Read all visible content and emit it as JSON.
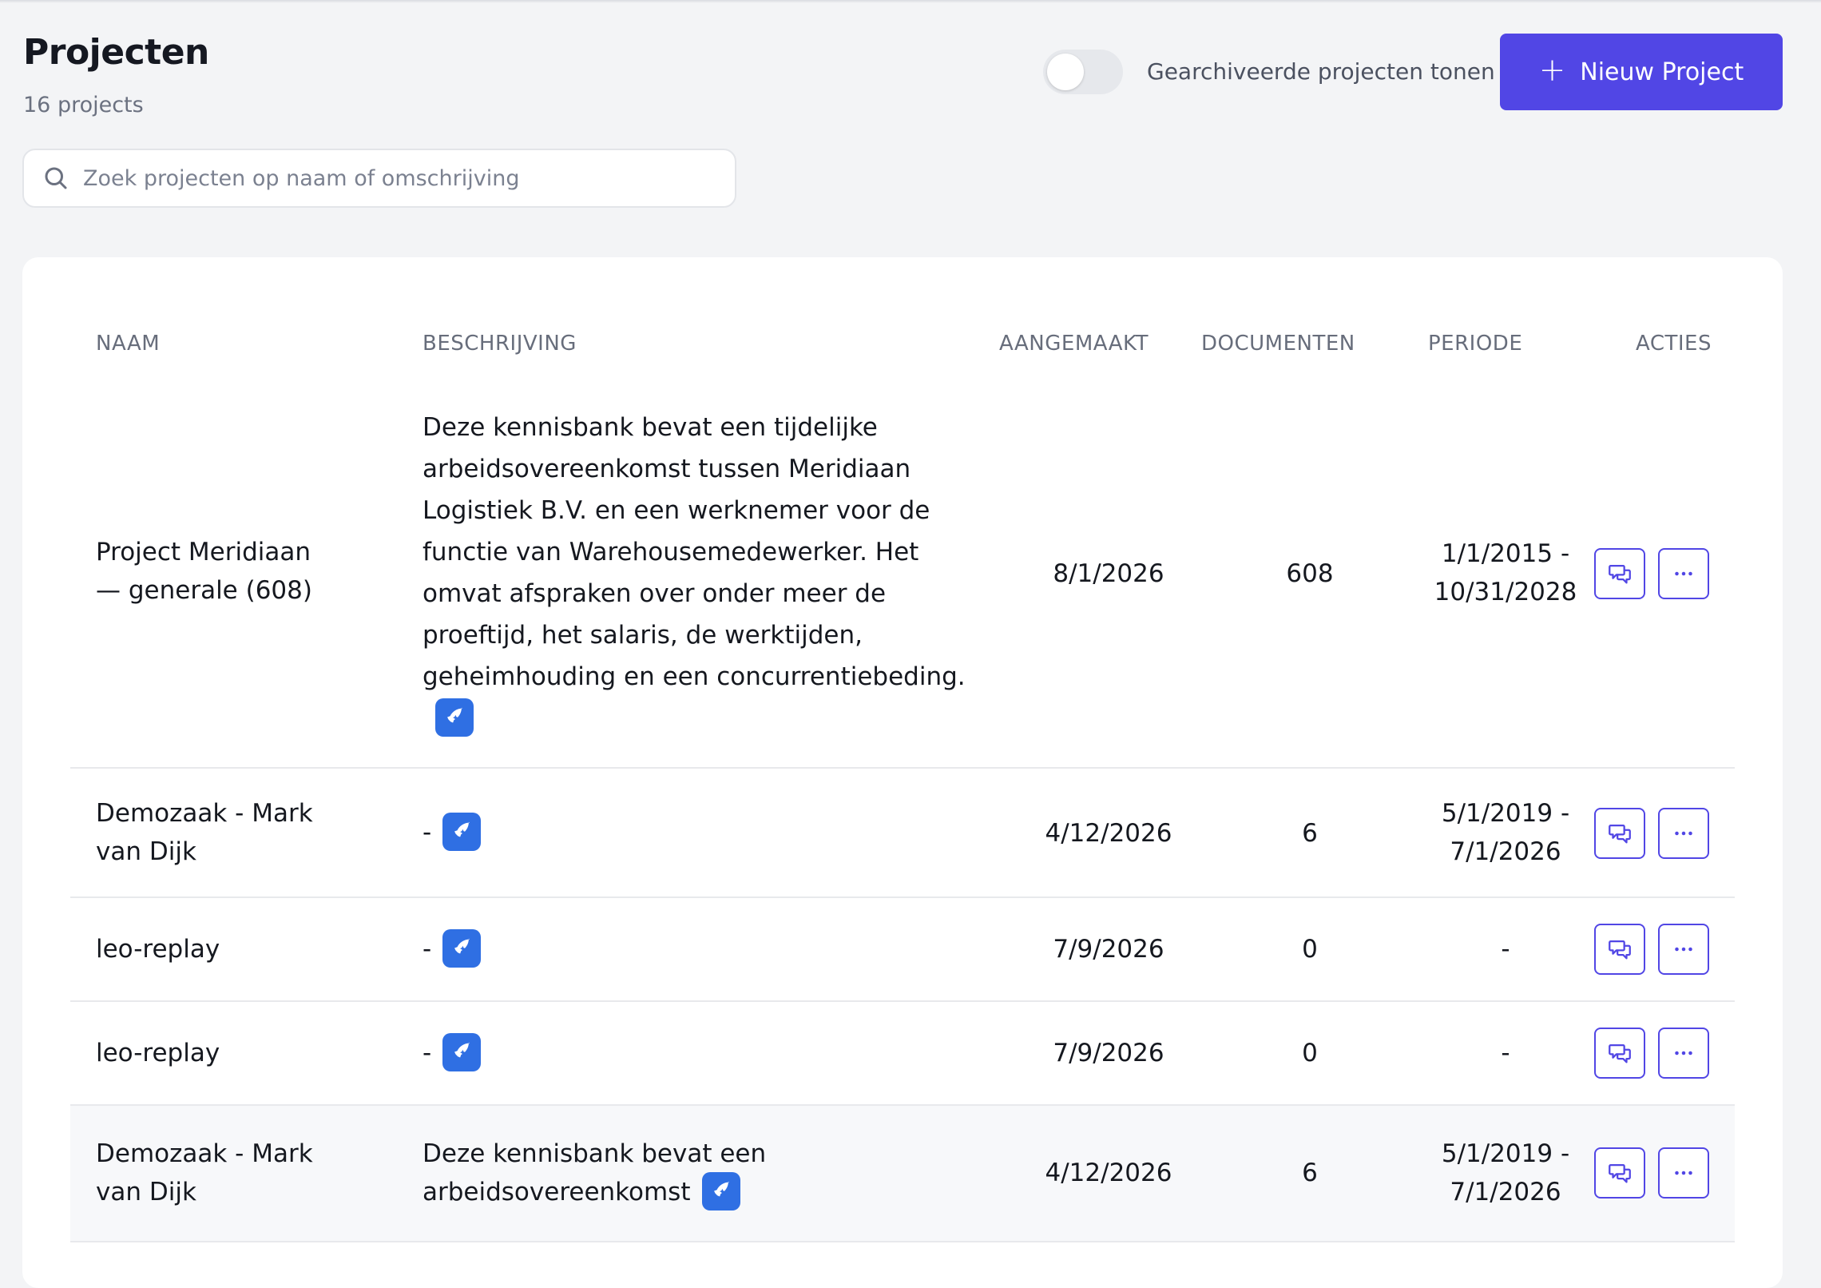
{
  "header": {
    "title": "Projecten",
    "count": "16 projects",
    "archived_toggle_label": "Gearchiveerde projecten tonen",
    "archived_toggle_on": false,
    "new_button_label": "Nieuw Project"
  },
  "search": {
    "placeholder": "Zoek projecten op naam of omschrijving",
    "value": ""
  },
  "table": {
    "columns": [
      "NAAM",
      "BESCHRIJVING",
      "AANGEMAAKT",
      "DOCUMENTEN",
      "PERIODE",
      "ACTIES"
    ],
    "rows": [
      {
        "name_1": "Project Meridiaan",
        "name_2": "— generale (608)",
        "desc_lines": [
          "Deze kennisbank bevat een tijdelijke",
          "arbeidsovereenkomst tussen Meridiaan",
          "Logistiek B.V. en een werknemer voor de",
          "functie van Warehousemedewerker. Het",
          "omvat afspraken over onder meer de",
          "proeftijd, het salaris, de werktijden,",
          "geheimhouding en een concurrentiebeding."
        ],
        "created": "8/1/2026",
        "documents": "608",
        "period_1": "1/1/2015 -",
        "period_2": "10/31/2028"
      },
      {
        "name_1": "Demozaak - Mark",
        "name_2": "van Dijk",
        "desc_lines": [
          "-"
        ],
        "created": "4/12/2026",
        "documents": "6",
        "period_1": "5/1/2019 -",
        "period_2": "7/1/2026"
      },
      {
        "name_1": "leo-replay",
        "desc_lines": [
          "-"
        ],
        "created": "7/9/2026",
        "documents": "0",
        "period_1": "-"
      },
      {
        "name_1": "leo-replay",
        "desc_lines": [
          "-"
        ],
        "created": "7/9/2026",
        "documents": "0",
        "period_1": "-"
      },
      {
        "name_1": "Demozaak - Mark",
        "name_2": "van Dijk",
        "desc_lines": [
          "Deze kennisbank bevat een",
          "arbeidsovereenkomst"
        ],
        "created": "4/12/2026",
        "documents": "6",
        "period_1": "5/1/2019 -",
        "period_2": "7/1/2026"
      }
    ]
  },
  "icons": {
    "search": "search-icon",
    "new": "plus-icon",
    "ai_badge": "ai-sparkle-icon",
    "chat_action": "chat-icon",
    "more_action": "more-dots-icon"
  },
  "colors": {
    "accent": "#5146e5",
    "ai_badge": "#2f6fe3",
    "background": "#f3f4f6",
    "card": "#ffffff"
  }
}
